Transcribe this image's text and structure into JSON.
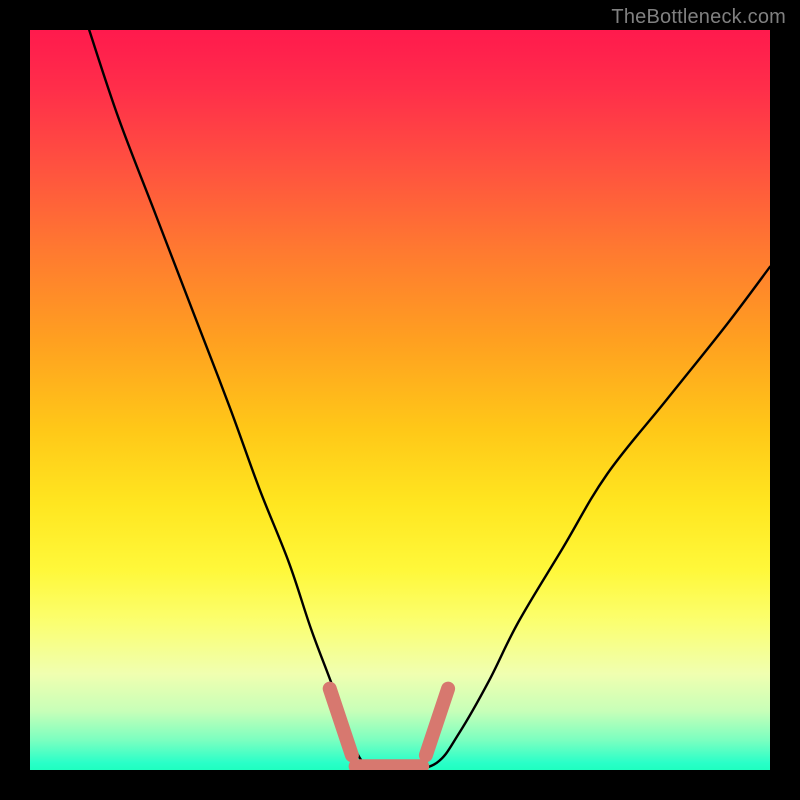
{
  "watermark": "TheBottleneck.com",
  "colors": {
    "frame": "#000000",
    "curve_stroke": "#000000",
    "marker_stroke": "#d7786f",
    "watermark": "#808080"
  },
  "chart_data": {
    "type": "line",
    "title": "",
    "subtitle": "",
    "xlabel": "",
    "ylabel": "",
    "xlim": [
      0,
      100
    ],
    "ylim": [
      0,
      100
    ],
    "grid": false,
    "legend": false,
    "note": "No numeric axis ticks or data labels are rendered in the image; values below are approximate readings of the visible curve geometry on a 0–100 normalized scale.",
    "series": [
      {
        "name": "bottleneck-curve",
        "x": [
          8,
          12,
          17,
          22,
          27,
          31,
          35,
          38,
          41,
          43,
          45,
          47,
          51,
          55,
          58,
          62,
          66,
          72,
          78,
          86,
          94,
          100
        ],
        "y": [
          100,
          88,
          75,
          62,
          49,
          38,
          28,
          19,
          11,
          5,
          1,
          0,
          0,
          1,
          5,
          12,
          20,
          30,
          40,
          50,
          60,
          68
        ]
      }
    ],
    "markers": {
      "name": "highlighted-minimum",
      "style": "thick-rounded",
      "color": "#d7786f",
      "segments": [
        {
          "x": [
            40.5,
            43.5
          ],
          "y": [
            11,
            2
          ]
        },
        {
          "x": [
            44,
            53
          ],
          "y": [
            0.5,
            0.5
          ]
        },
        {
          "x": [
            53.5,
            56.5
          ],
          "y": [
            2,
            11
          ]
        }
      ]
    },
    "background_gradient": {
      "direction": "top-to-bottom",
      "stops": [
        {
          "pos": 0.0,
          "color": "#ff1a4d"
        },
        {
          "pos": 0.3,
          "color": "#ff7a30"
        },
        {
          "pos": 0.64,
          "color": "#ffe620"
        },
        {
          "pos": 0.87,
          "color": "#f0ffb0"
        },
        {
          "pos": 1.0,
          "color": "#1fffc0"
        }
      ]
    }
  }
}
